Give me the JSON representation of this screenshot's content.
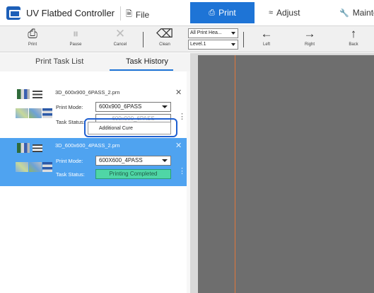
{
  "app": {
    "title": "UV Flatbed Controller"
  },
  "menu": {
    "file": "File",
    "print": "Print",
    "adjust": "Adjust",
    "maintenance": "Mainte"
  },
  "toolbar": {
    "print": "Print",
    "pause": "Pause",
    "cancel": "Cancel",
    "clean": "Clean",
    "head_select": "All Print Hea...",
    "level_select": "Level.1",
    "left": "Left",
    "right": "Right",
    "back": "Back"
  },
  "tabs": {
    "task_list": "Print Task List",
    "task_history": "Task History"
  },
  "tasks": [
    {
      "name": "3D_600x900_6PASS_2.prn",
      "mode_label": "Print Mode:",
      "mode_value": "600x900_6PASS",
      "status_label": "Task Status:",
      "status_value": "600x900_6PASS"
    },
    {
      "name": "3D_600x600_4PASS_2.prn",
      "mode_label": "Print Mode:",
      "mode_value": "600X600_4PASS",
      "status_label": "Task Status:",
      "status_value": "Printing Completed"
    }
  ],
  "popup": {
    "item": "Additional Cure"
  },
  "colors": {
    "accent": "#1e74d6",
    "selected_row": "#4fa3f0",
    "status_done": "#4fd6a6",
    "bed": "#6e6e6e",
    "bed_line": "#e0763a"
  }
}
